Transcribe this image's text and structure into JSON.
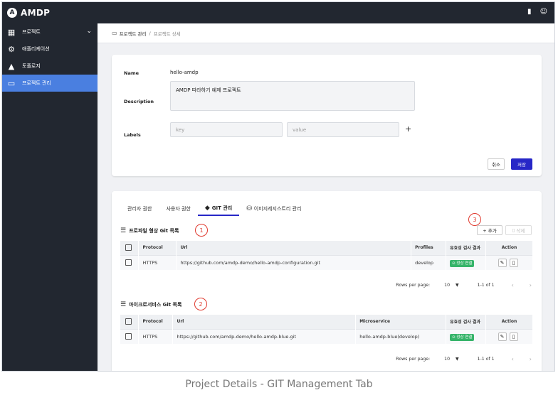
{
  "app": {
    "title": "AMDP",
    "logo_glyph": "A"
  },
  "topbar": {
    "doc_icon": "document-icon",
    "user_icon": "user-settings-icon"
  },
  "sidebar": {
    "items": [
      {
        "label": "프로젝트",
        "icon": "chart-icon",
        "active": false
      },
      {
        "label": "애플리케이션",
        "icon": "gear-icon",
        "active": false
      },
      {
        "label": "토폴로지",
        "icon": "topology-icon",
        "active": false
      },
      {
        "label": "프로젝트 관리",
        "icon": "monitor-icon",
        "active": true
      }
    ]
  },
  "breadcrumb": {
    "root": "프로젝트 관리",
    "separator": "/",
    "current": "프로젝트 상세"
  },
  "detail": {
    "name_label": "Name",
    "name_value": "hello-amdp",
    "description_label": "Description",
    "description_value": "AMDP 따라하기 예제 프로젝트",
    "labels_label": "Labels",
    "key_placeholder": "key",
    "value_placeholder": "value",
    "add_label_glyph": "+",
    "cancel": "취소",
    "save": "저장"
  },
  "tabs": [
    {
      "label": "관리자 권한"
    },
    {
      "label": "사용자 권한"
    },
    {
      "label": "GIT 관리"
    },
    {
      "label": "이미지레지스트리 관리"
    }
  ],
  "profile_section": {
    "title": "프로파일 형상 Git 목록",
    "marker": "1",
    "headers": [
      "Protocol",
      "Url",
      "Profiles",
      "유효성 검사 결과",
      "Action"
    ],
    "rows": [
      {
        "protocol": "HTTPS",
        "url": "https://github.com/amdp-demo/hello-amdp-configuration.git",
        "profiles": "develop",
        "status": "정상 연결"
      }
    ]
  },
  "toolbar": {
    "marker": "3",
    "add": "+ 추가",
    "delete": "삭제"
  },
  "ms_section": {
    "title": "마이크로서비스 Git 목록",
    "marker": "2",
    "headers": [
      "Protocol",
      "Url",
      "Microservice",
      "유효성 검사 결과",
      "Action"
    ],
    "rows": [
      {
        "protocol": "HTTPS",
        "url": "https://github.com/amdp-demo/hello-amdp-blue.git",
        "microservice": "hello-amdp-blue(develop)",
        "status": "정상 연결"
      }
    ]
  },
  "pagination": {
    "rows_per_page_label": "Rows per page:",
    "rows_per_page": "10",
    "range": "1-1 of 1"
  },
  "caption": "Project Details - GIT Management Tab",
  "colors": {
    "accent": "#2727c7",
    "sidebar_active": "#4a7fe0",
    "status_ok": "#36b46a",
    "marker": "#e03a2f"
  }
}
